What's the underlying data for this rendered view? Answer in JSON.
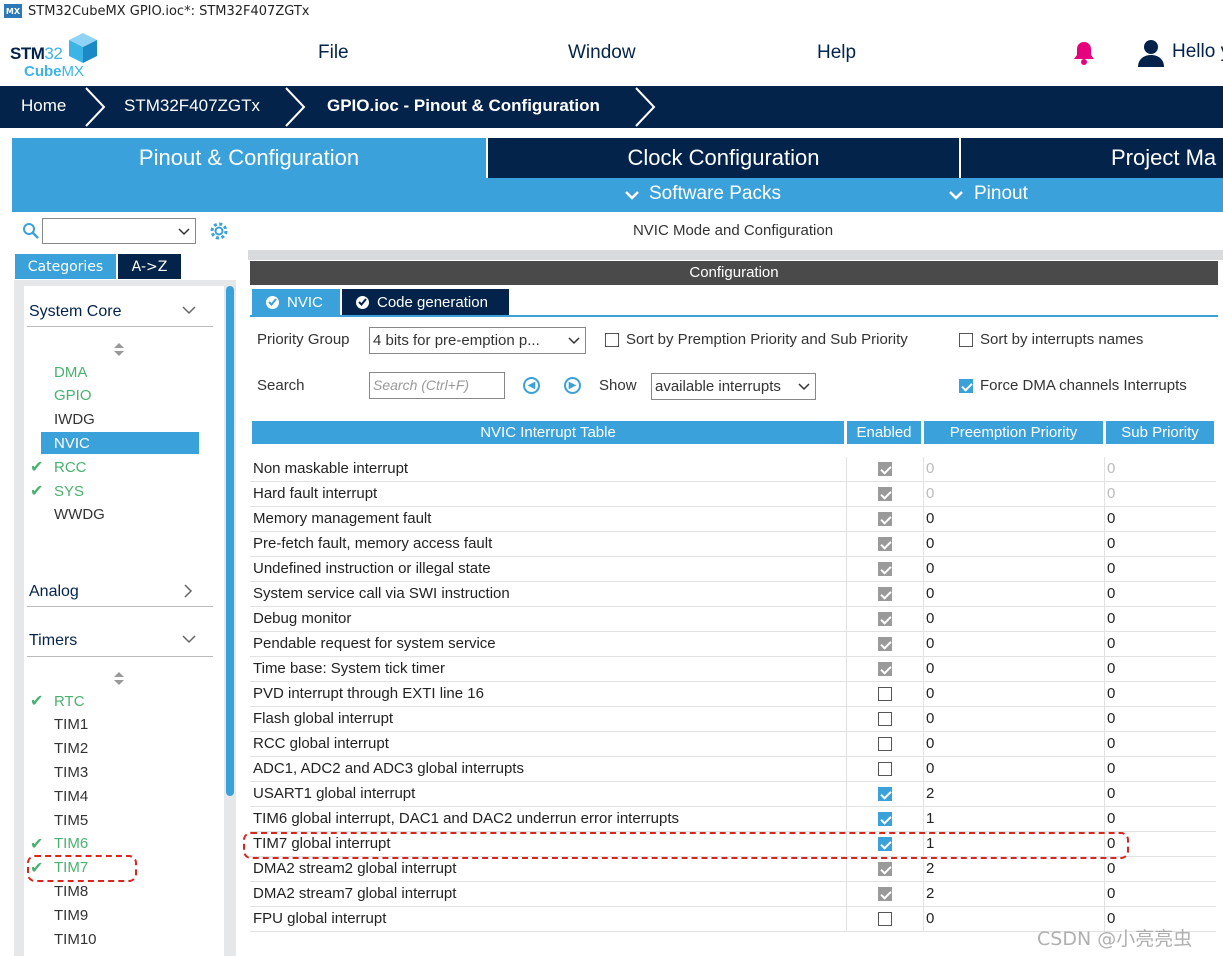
{
  "window_title": "STM32CubeMX GPIO.ioc*: STM32F407ZGTx",
  "app_badge": "MX",
  "menu": {
    "file": "File",
    "window": "Window",
    "help": "Help",
    "user": "Hello y"
  },
  "breadcrumb": [
    "Home",
    "STM32F407ZGTx",
    "GPIO.ioc - Pinout & Configuration"
  ],
  "main_tabs": [
    "Pinout & Configuration",
    "Clock Configuration",
    "Project Ma"
  ],
  "sub_menu": {
    "software_packs": "Software Packs",
    "pinout": "Pinout"
  },
  "left_panel": {
    "tabs": [
      "Categories",
      "A->Z"
    ],
    "system_core": {
      "label": "System Core",
      "items": [
        {
          "label": "DMA",
          "state": "green",
          "check": false
        },
        {
          "label": "GPIO",
          "state": "green",
          "check": false
        },
        {
          "label": "IWDG",
          "state": "normal",
          "check": false
        },
        {
          "label": "NVIC",
          "state": "selected",
          "check": false
        },
        {
          "label": "RCC",
          "state": "green",
          "check": true
        },
        {
          "label": "SYS",
          "state": "green",
          "check": true
        },
        {
          "label": "WWDG",
          "state": "normal",
          "check": false
        }
      ]
    },
    "analog": {
      "label": "Analog"
    },
    "timers": {
      "label": "Timers",
      "items": [
        {
          "label": "RTC",
          "state": "green",
          "check": true
        },
        {
          "label": "TIM1",
          "state": "normal",
          "check": false
        },
        {
          "label": "TIM2",
          "state": "normal",
          "check": false
        },
        {
          "label": "TIM3",
          "state": "normal",
          "check": false
        },
        {
          "label": "TIM4",
          "state": "normal",
          "check": false
        },
        {
          "label": "TIM5",
          "state": "normal",
          "check": false
        },
        {
          "label": "TIM6",
          "state": "green",
          "check": true
        },
        {
          "label": "TIM7",
          "state": "green",
          "check": true
        },
        {
          "label": "TIM8",
          "state": "normal",
          "check": false
        },
        {
          "label": "TIM9",
          "state": "normal",
          "check": false
        },
        {
          "label": "TIM10",
          "state": "normal",
          "check": false
        }
      ]
    }
  },
  "right_panel": {
    "mode_title": "NVIC Mode and Configuration",
    "config_title": "Configuration",
    "tabs": [
      "NVIC",
      "Code generation"
    ],
    "priority_group_label": "Priority Group",
    "priority_group_value": "4 bits for pre-emption p...",
    "sort_premption_label": "Sort by Premption Priority and Sub Priority",
    "sort_names_label": "Sort by interrupts names",
    "search_label": "Search",
    "search_placeholder": "Search (Ctrl+F)",
    "show_label": "Show",
    "show_value": "available interrupts",
    "force_dma_label": "Force DMA channels Interrupts",
    "table_headers": [
      "NVIC Interrupt Table",
      "Enabled",
      "Preemption Priority",
      "Sub Priority"
    ],
    "rows": [
      {
        "name": "Non maskable interrupt",
        "enabled": "grey",
        "pp": "0",
        "sp": "0",
        "dim": true
      },
      {
        "name": "Hard fault interrupt",
        "enabled": "grey",
        "pp": "0",
        "sp": "0",
        "dim": true
      },
      {
        "name": "Memory management fault",
        "enabled": "grey",
        "pp": "0",
        "sp": "0",
        "dim": false
      },
      {
        "name": "Pre-fetch fault, memory access fault",
        "enabled": "grey",
        "pp": "0",
        "sp": "0",
        "dim": false
      },
      {
        "name": "Undefined instruction or illegal state",
        "enabled": "grey",
        "pp": "0",
        "sp": "0",
        "dim": false
      },
      {
        "name": "System service call via SWI instruction",
        "enabled": "grey",
        "pp": "0",
        "sp": "0",
        "dim": false
      },
      {
        "name": "Debug monitor",
        "enabled": "grey",
        "pp": "0",
        "sp": "0",
        "dim": false
      },
      {
        "name": "Pendable request for system service",
        "enabled": "grey",
        "pp": "0",
        "sp": "0",
        "dim": false
      },
      {
        "name": "Time base: System tick timer",
        "enabled": "grey",
        "pp": "0",
        "sp": "0",
        "dim": false
      },
      {
        "name": "PVD interrupt through EXTI line 16",
        "enabled": "off",
        "pp": "0",
        "sp": "0",
        "dim": false
      },
      {
        "name": "Flash global interrupt",
        "enabled": "off",
        "pp": "0",
        "sp": "0",
        "dim": false
      },
      {
        "name": "RCC global interrupt",
        "enabled": "off",
        "pp": "0",
        "sp": "0",
        "dim": false
      },
      {
        "name": "ADC1, ADC2 and ADC3 global interrupts",
        "enabled": "off",
        "pp": "0",
        "sp": "0",
        "dim": false
      },
      {
        "name": "USART1 global interrupt",
        "enabled": "blue",
        "pp": "2",
        "sp": "0",
        "dim": false
      },
      {
        "name": "TIM6 global interrupt, DAC1 and DAC2 underrun error interrupts",
        "enabled": "blue",
        "pp": "1",
        "sp": "0",
        "dim": false
      },
      {
        "name": "TIM7 global interrupt",
        "enabled": "blue",
        "pp": "1",
        "sp": "0",
        "dim": false
      },
      {
        "name": "DMA2 stream2 global interrupt",
        "enabled": "grey",
        "pp": "2",
        "sp": "0",
        "dim": false
      },
      {
        "name": "DMA2 stream7 global interrupt",
        "enabled": "grey",
        "pp": "2",
        "sp": "0",
        "dim": false
      },
      {
        "name": "FPU global interrupt",
        "enabled": "off",
        "pp": "0",
        "sp": "0",
        "dim": false
      }
    ]
  },
  "watermark": "CSDN @小亮亮虫",
  "colors": {
    "navy": "#03234b",
    "accent": "#3ba1da",
    "green": "#49b170",
    "highlight": "#d9251d"
  }
}
